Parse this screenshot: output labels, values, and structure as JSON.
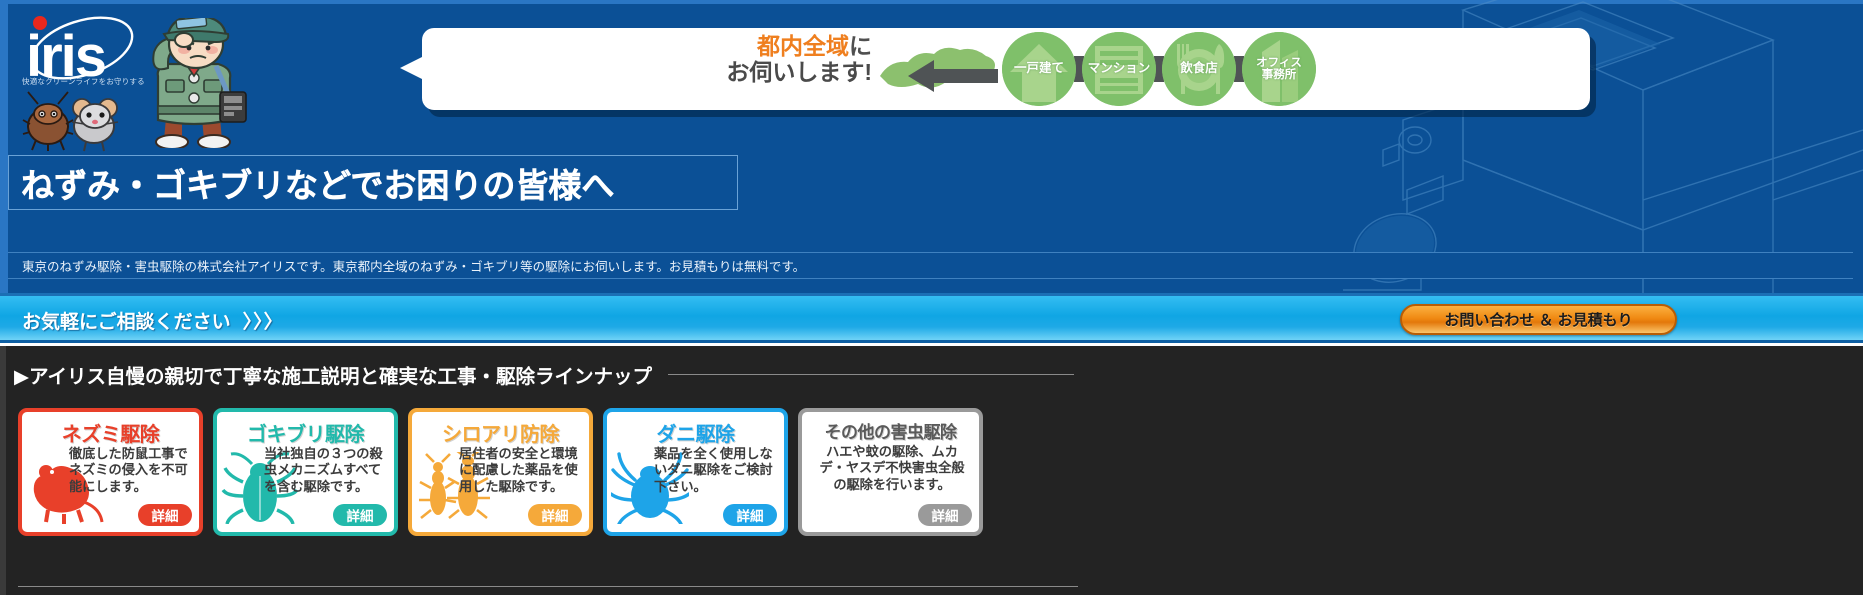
{
  "brand": {
    "logo_text": "iris",
    "tagline": "快適なクリーンライフをお守りする"
  },
  "hero": {
    "bubble": {
      "line1_highlight": "都内全域",
      "line1_suffix": "に",
      "line2": "お伺いします!",
      "map_icon": "japan-kanto-map-icon",
      "arrow_icon": "left-arrow-icon",
      "targets": [
        {
          "label": "一戸建て",
          "icon": "house-icon"
        },
        {
          "label": "マンション",
          "icon": "apartment-building-icon"
        },
        {
          "label": "飲食店",
          "icon": "fork-plate-icon"
        },
        {
          "label_line1": "オフィス",
          "label_line2": "事務所",
          "icon": "office-building-icon"
        }
      ]
    },
    "headline": "ねずみ・ゴキブリなどでお困りの皆様へ",
    "description": "東京のねずみ駆除・害虫駆除の株式会社アイリスです。東京都内全域のねずみ・ゴキブリ等の駆除にお伺いします。お見積もりは無料です。"
  },
  "cta_bar": {
    "message": "お気軽にご相談ください",
    "chevrons": "〉〉〉",
    "contact_button": "お問い合わせ ＆ お見積もり"
  },
  "lineup": {
    "title": "▶アイリス自慢の親切で丁寧な施工説明と確実な工事・駆除ラインナップ",
    "detail_label": "詳細",
    "cards": [
      {
        "title": "ネズミ駆除",
        "body": "徹底した防鼠工事でネズミの侵入を不可能にします。",
        "detail": "詳細",
        "icon": "rat-silhouette-icon",
        "color": "#e8402a"
      },
      {
        "title": "ゴキブリ駆除",
        "body": "当社独自の３つの殺虫メカニズムすべてを含む駆除です。",
        "detail": "詳細",
        "icon": "cockroach-silhouette-icon",
        "color": "#22b9ab"
      },
      {
        "title": "シロアリ防除",
        "body": "居住者の安全と環境に配慮した薬品を使用した駆除です。",
        "detail": "詳細",
        "icon": "termite-silhouette-icon",
        "color": "#f5a93a"
      },
      {
        "title": "ダニ駆除",
        "body": "薬品を全く使用しないダニ駆除をご検討下さい。",
        "detail": "詳細",
        "icon": "mite-silhouette-icon",
        "color": "#1ea4e8"
      },
      {
        "title": "その他の害虫駆除",
        "body": "ハエや蚊の駆除、ムカデ・ヤスデ不快害虫全般の駆除を行います。",
        "detail": "詳細",
        "icon": "generic-pest-icon",
        "color": "#9a9a9a"
      }
    ]
  },
  "colors": {
    "hero_blue": "#0b5096",
    "cyan": "#19a9e6",
    "orange": "#ef8a14",
    "dark": "#232323",
    "green": "#7fc06a"
  }
}
